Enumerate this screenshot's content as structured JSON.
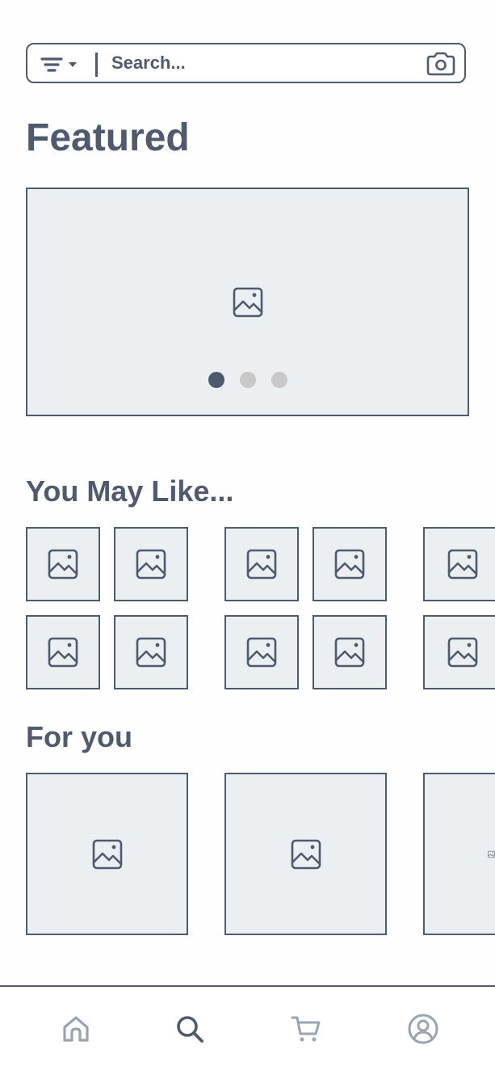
{
  "search": {
    "placeholder": "Search...",
    "filter_icon": "filter-icon",
    "camera_icon": "camera-icon"
  },
  "featured": {
    "title": "Featured",
    "carousel_pages": 3,
    "active_page": 1
  },
  "you_may_like": {
    "title": "You May Like..."
  },
  "for_you": {
    "title": "For you"
  },
  "bottom_nav": {
    "items": [
      {
        "icon": "home-icon",
        "active": false
      },
      {
        "icon": "search-icon",
        "active": true
      },
      {
        "icon": "cart-icon",
        "active": false
      },
      {
        "icon": "profile-icon",
        "active": false
      }
    ]
  },
  "colors": {
    "primary": "#4f5a6e",
    "inactive": "#9aa3b2",
    "placeholder_bg": "#eceff2",
    "dot_inactive": "#c9c8c8"
  }
}
